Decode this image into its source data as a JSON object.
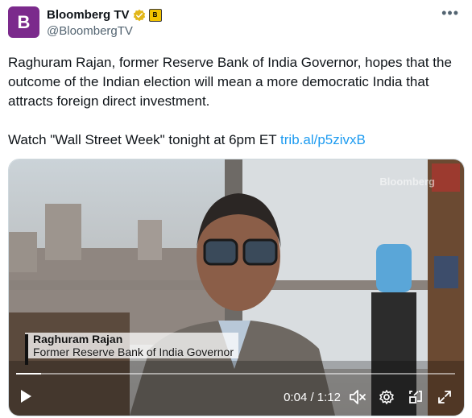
{
  "account": {
    "name": "Bloomberg TV",
    "handle": "@BloombergTV",
    "avatar_letter": "B",
    "affiliate_badge": "B"
  },
  "tweet": {
    "paragraph1": "Raghuram Rajan, former Reserve Bank of India Governor, hopes that the outcome of the Indian election will mean a more democratic India that attracts foreign direct investment.",
    "paragraph2_prefix": "Watch \"Wall Street Week\" tonight at 6pm ET ",
    "link": "trib.al/p5zivxB"
  },
  "video": {
    "watermark": "Bloomberg",
    "lower_third_name": "Raghuram Rajan",
    "lower_third_title": "Former Reserve Bank of India Governor",
    "time": "0:04 / 1:12",
    "progress": 0.056
  },
  "colors": {
    "link": "#1d9bf0",
    "avatar_bg": "#7b2a8c",
    "verified": "#e2b719"
  },
  "icons": {
    "more": "more-icon",
    "verified": "verified-badge-icon",
    "play": "play-icon",
    "mute": "volume-mute-icon",
    "settings": "settings-icon",
    "pip": "picture-in-picture-icon",
    "fullscreen": "fullscreen-icon"
  }
}
